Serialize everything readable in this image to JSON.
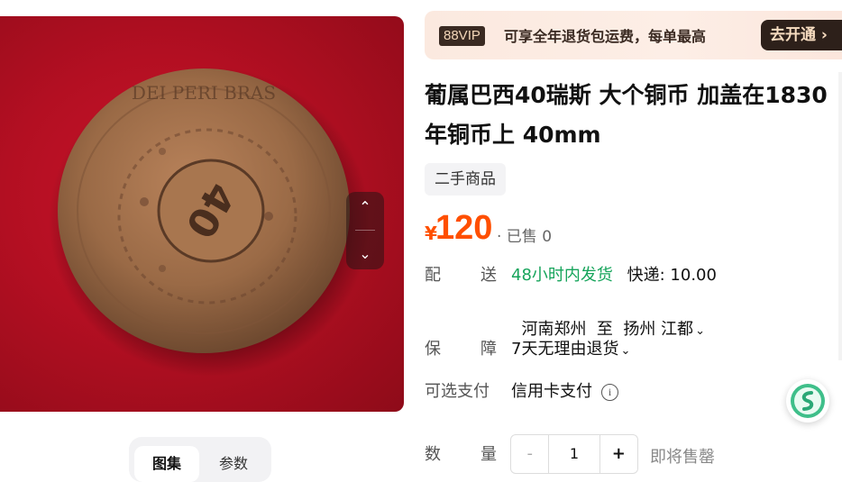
{
  "vip": {
    "logo": "88VIP",
    "text": "可享全年退货包运费，每单最高",
    "button": "去开通 ›"
  },
  "product": {
    "title_line1": "葡属巴西40瑞斯 大个铜币 加盖在1830",
    "title_line2": "年铜币上 40mm",
    "condition_tag": "二手商品",
    "currency": "¥",
    "price": "120",
    "sold": "· 已售 0"
  },
  "shipping": {
    "label_a": "配",
    "label_b": "送",
    "speed": "48小时内发货",
    "fee": "快递: 10.00",
    "route": "河南郑州  至  扬州 江都"
  },
  "guarantee": {
    "label_a": "保",
    "label_b": "障",
    "value": "7天无理由退货"
  },
  "payment": {
    "label": "可选支付",
    "value": "信用卡支付",
    "info_icon": "i"
  },
  "quantity": {
    "label_a": "数",
    "label_b": "量",
    "minus": "-",
    "value": "1",
    "plus": "+",
    "status": "即将售罄"
  },
  "view_tabs": [
    "图集",
    "参数"
  ],
  "icons": {
    "image_prev": "chevron-up-icon",
    "image_next": "chevron-down-icon",
    "route_expand": "chevron-down-icon",
    "guarantee_expand": "chevron-down-icon",
    "info": "info-circle-icon",
    "float_badge": "app-logo-icon"
  },
  "colors": {
    "price": "#ff4f00",
    "accent_green": "#16a45b",
    "vip_button_bg": "#2d201a",
    "banner_bg": "#fbe9df"
  }
}
